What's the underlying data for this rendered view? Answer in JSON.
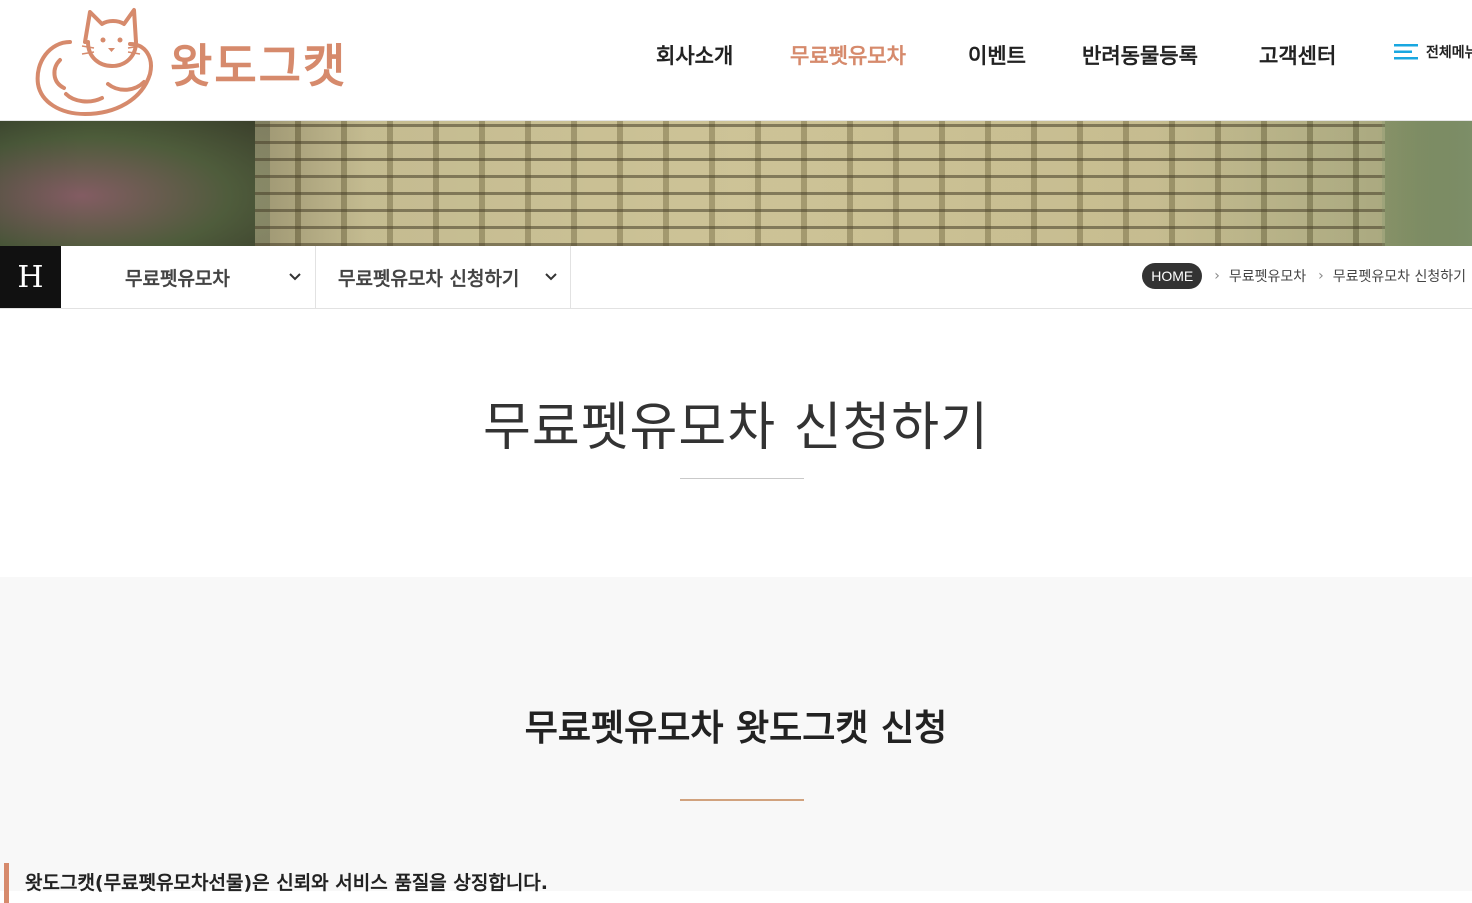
{
  "brand": {
    "name": "왓도그캣",
    "color": "#d68a6c"
  },
  "nav": {
    "items": [
      {
        "label": "회사소개",
        "active": false
      },
      {
        "label": "무료펫유모차",
        "active": true
      },
      {
        "label": "이벤트",
        "active": false
      },
      {
        "label": "반려동물등록",
        "active": false
      },
      {
        "label": "고객센터",
        "active": false
      }
    ],
    "all_menu_label": "전체메뉴",
    "all_menu_icon": "hamburger-icon"
  },
  "subnav": {
    "home_letter": "H",
    "dropdown1": "무료펫유모차",
    "dropdown2": "무료펫유모차 신청하기",
    "breadcrumb": {
      "home": "HOME",
      "level1": "무료펫유모차",
      "level2": "무료펫유모차 신청하기"
    }
  },
  "page": {
    "title": "무료펫유모차 신청하기",
    "section_title": "무료펫유모차 왓도그캣 신청",
    "intro": "왓도그캣(무료펫유모차선물)은 신뢰와 서비스 품질을 상징합니다."
  },
  "colors": {
    "accent": "#d68a6c",
    "line": "#d1a27e",
    "dark": "#111111",
    "section_bg": "#f8f8f8"
  }
}
